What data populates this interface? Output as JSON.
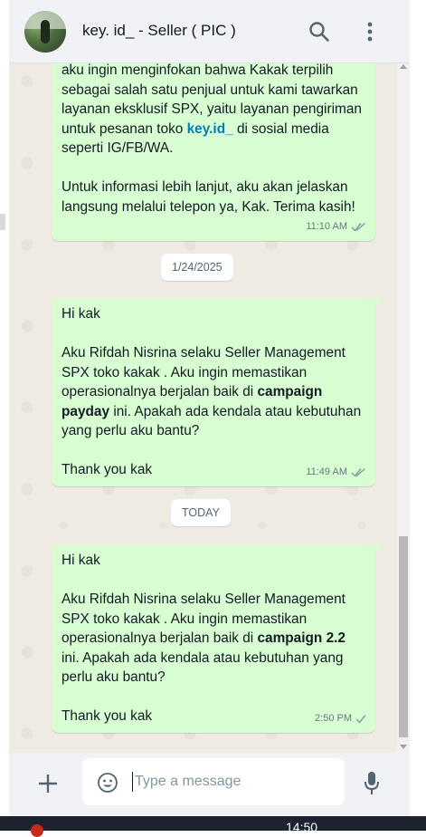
{
  "header": {
    "title": "key. id_ - Seller ( PIC )",
    "avatar_icon": "profile-photo",
    "search_icon": "search-icon",
    "menu_icon": "kebab-menu-icon"
  },
  "messages": [
    {
      "lines_before_link": "aku ingin menginfokan bahwa Kakak terpilih sebagai salah satu penjual untuk kami tawarkan layanan eksklusif SPX, yaitu layanan pengiriman untuk pesanan toko ",
      "link": "key.id_",
      "lines_after_link": "  di sosial media seperti IG/FB/WA.\n\nUntuk informasi lebih lanjut, aku akan jelaskan langsung melalui telepon ya, Kak. Terima kasih!",
      "time": "11:10 AM",
      "status": "read"
    },
    {
      "text_before_bold": "Hi kak\n\nAku Rifdah Nisrina selaku Seller Management SPX toko kakak . Aku ingin memastikan operasionalnya berjalan baik di ",
      "bold": "campaign payday",
      "text_after_bold": " ini. Apakah ada kendala atau kebutuhan yang perlu aku bantu?\n\nThank you kak",
      "time": "11:49 AM",
      "status": "read"
    },
    {
      "text_before_bold": "Hi kak\n\nAku Rifdah Nisrina selaku Seller Management SPX toko kakak . Aku ingin memastikan operasionalnya berjalan baik di ",
      "bold": "campaign 2.2",
      "text_after_bold": " ini. Apakah ada kendala atau kebutuhan yang perlu aku bantu?\n\nThank you kak",
      "time": "2:50 PM",
      "status": "sent"
    }
  ],
  "dates": {
    "first": "1/24/2025",
    "second": "TODAY"
  },
  "composer": {
    "placeholder": "Type a message",
    "value": ""
  },
  "taskbar": {
    "clock": "14:50"
  },
  "colors": {
    "bubble_out": "#d9fdd3",
    "chat_bg": "#efeae2",
    "link": "#027eb5",
    "read_check": "#8696a0"
  }
}
